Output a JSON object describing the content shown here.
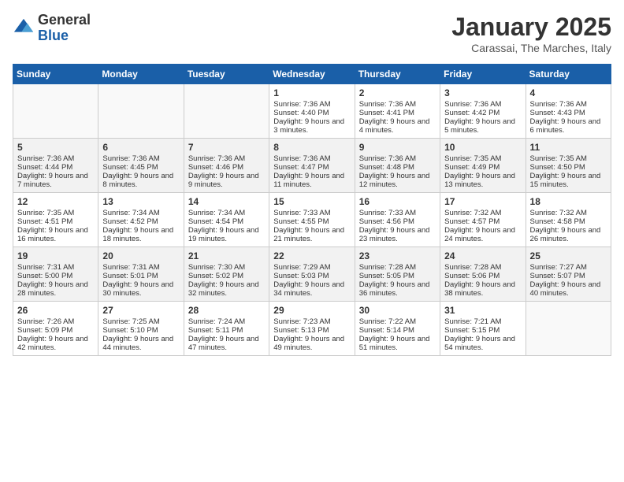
{
  "header": {
    "logo_general": "General",
    "logo_blue": "Blue",
    "month_title": "January 2025",
    "location": "Carassai, The Marches, Italy"
  },
  "weekdays": [
    "Sunday",
    "Monday",
    "Tuesday",
    "Wednesday",
    "Thursday",
    "Friday",
    "Saturday"
  ],
  "weeks": [
    [
      {
        "day": "",
        "info": ""
      },
      {
        "day": "",
        "info": ""
      },
      {
        "day": "",
        "info": ""
      },
      {
        "day": "1",
        "info": "Sunrise: 7:36 AM\nSunset: 4:40 PM\nDaylight: 9 hours and 3 minutes."
      },
      {
        "day": "2",
        "info": "Sunrise: 7:36 AM\nSunset: 4:41 PM\nDaylight: 9 hours and 4 minutes."
      },
      {
        "day": "3",
        "info": "Sunrise: 7:36 AM\nSunset: 4:42 PM\nDaylight: 9 hours and 5 minutes."
      },
      {
        "day": "4",
        "info": "Sunrise: 7:36 AM\nSunset: 4:43 PM\nDaylight: 9 hours and 6 minutes."
      }
    ],
    [
      {
        "day": "5",
        "info": "Sunrise: 7:36 AM\nSunset: 4:44 PM\nDaylight: 9 hours and 7 minutes."
      },
      {
        "day": "6",
        "info": "Sunrise: 7:36 AM\nSunset: 4:45 PM\nDaylight: 9 hours and 8 minutes."
      },
      {
        "day": "7",
        "info": "Sunrise: 7:36 AM\nSunset: 4:46 PM\nDaylight: 9 hours and 9 minutes."
      },
      {
        "day": "8",
        "info": "Sunrise: 7:36 AM\nSunset: 4:47 PM\nDaylight: 9 hours and 11 minutes."
      },
      {
        "day": "9",
        "info": "Sunrise: 7:36 AM\nSunset: 4:48 PM\nDaylight: 9 hours and 12 minutes."
      },
      {
        "day": "10",
        "info": "Sunrise: 7:35 AM\nSunset: 4:49 PM\nDaylight: 9 hours and 13 minutes."
      },
      {
        "day": "11",
        "info": "Sunrise: 7:35 AM\nSunset: 4:50 PM\nDaylight: 9 hours and 15 minutes."
      }
    ],
    [
      {
        "day": "12",
        "info": "Sunrise: 7:35 AM\nSunset: 4:51 PM\nDaylight: 9 hours and 16 minutes."
      },
      {
        "day": "13",
        "info": "Sunrise: 7:34 AM\nSunset: 4:52 PM\nDaylight: 9 hours and 18 minutes."
      },
      {
        "day": "14",
        "info": "Sunrise: 7:34 AM\nSunset: 4:54 PM\nDaylight: 9 hours and 19 minutes."
      },
      {
        "day": "15",
        "info": "Sunrise: 7:33 AM\nSunset: 4:55 PM\nDaylight: 9 hours and 21 minutes."
      },
      {
        "day": "16",
        "info": "Sunrise: 7:33 AM\nSunset: 4:56 PM\nDaylight: 9 hours and 23 minutes."
      },
      {
        "day": "17",
        "info": "Sunrise: 7:32 AM\nSunset: 4:57 PM\nDaylight: 9 hours and 24 minutes."
      },
      {
        "day": "18",
        "info": "Sunrise: 7:32 AM\nSunset: 4:58 PM\nDaylight: 9 hours and 26 minutes."
      }
    ],
    [
      {
        "day": "19",
        "info": "Sunrise: 7:31 AM\nSunset: 5:00 PM\nDaylight: 9 hours and 28 minutes."
      },
      {
        "day": "20",
        "info": "Sunrise: 7:31 AM\nSunset: 5:01 PM\nDaylight: 9 hours and 30 minutes."
      },
      {
        "day": "21",
        "info": "Sunrise: 7:30 AM\nSunset: 5:02 PM\nDaylight: 9 hours and 32 minutes."
      },
      {
        "day": "22",
        "info": "Sunrise: 7:29 AM\nSunset: 5:03 PM\nDaylight: 9 hours and 34 minutes."
      },
      {
        "day": "23",
        "info": "Sunrise: 7:28 AM\nSunset: 5:05 PM\nDaylight: 9 hours and 36 minutes."
      },
      {
        "day": "24",
        "info": "Sunrise: 7:28 AM\nSunset: 5:06 PM\nDaylight: 9 hours and 38 minutes."
      },
      {
        "day": "25",
        "info": "Sunrise: 7:27 AM\nSunset: 5:07 PM\nDaylight: 9 hours and 40 minutes."
      }
    ],
    [
      {
        "day": "26",
        "info": "Sunrise: 7:26 AM\nSunset: 5:09 PM\nDaylight: 9 hours and 42 minutes."
      },
      {
        "day": "27",
        "info": "Sunrise: 7:25 AM\nSunset: 5:10 PM\nDaylight: 9 hours and 44 minutes."
      },
      {
        "day": "28",
        "info": "Sunrise: 7:24 AM\nSunset: 5:11 PM\nDaylight: 9 hours and 47 minutes."
      },
      {
        "day": "29",
        "info": "Sunrise: 7:23 AM\nSunset: 5:13 PM\nDaylight: 9 hours and 49 minutes."
      },
      {
        "day": "30",
        "info": "Sunrise: 7:22 AM\nSunset: 5:14 PM\nDaylight: 9 hours and 51 minutes."
      },
      {
        "day": "31",
        "info": "Sunrise: 7:21 AM\nSunset: 5:15 PM\nDaylight: 9 hours and 54 minutes."
      },
      {
        "day": "",
        "info": ""
      }
    ]
  ]
}
